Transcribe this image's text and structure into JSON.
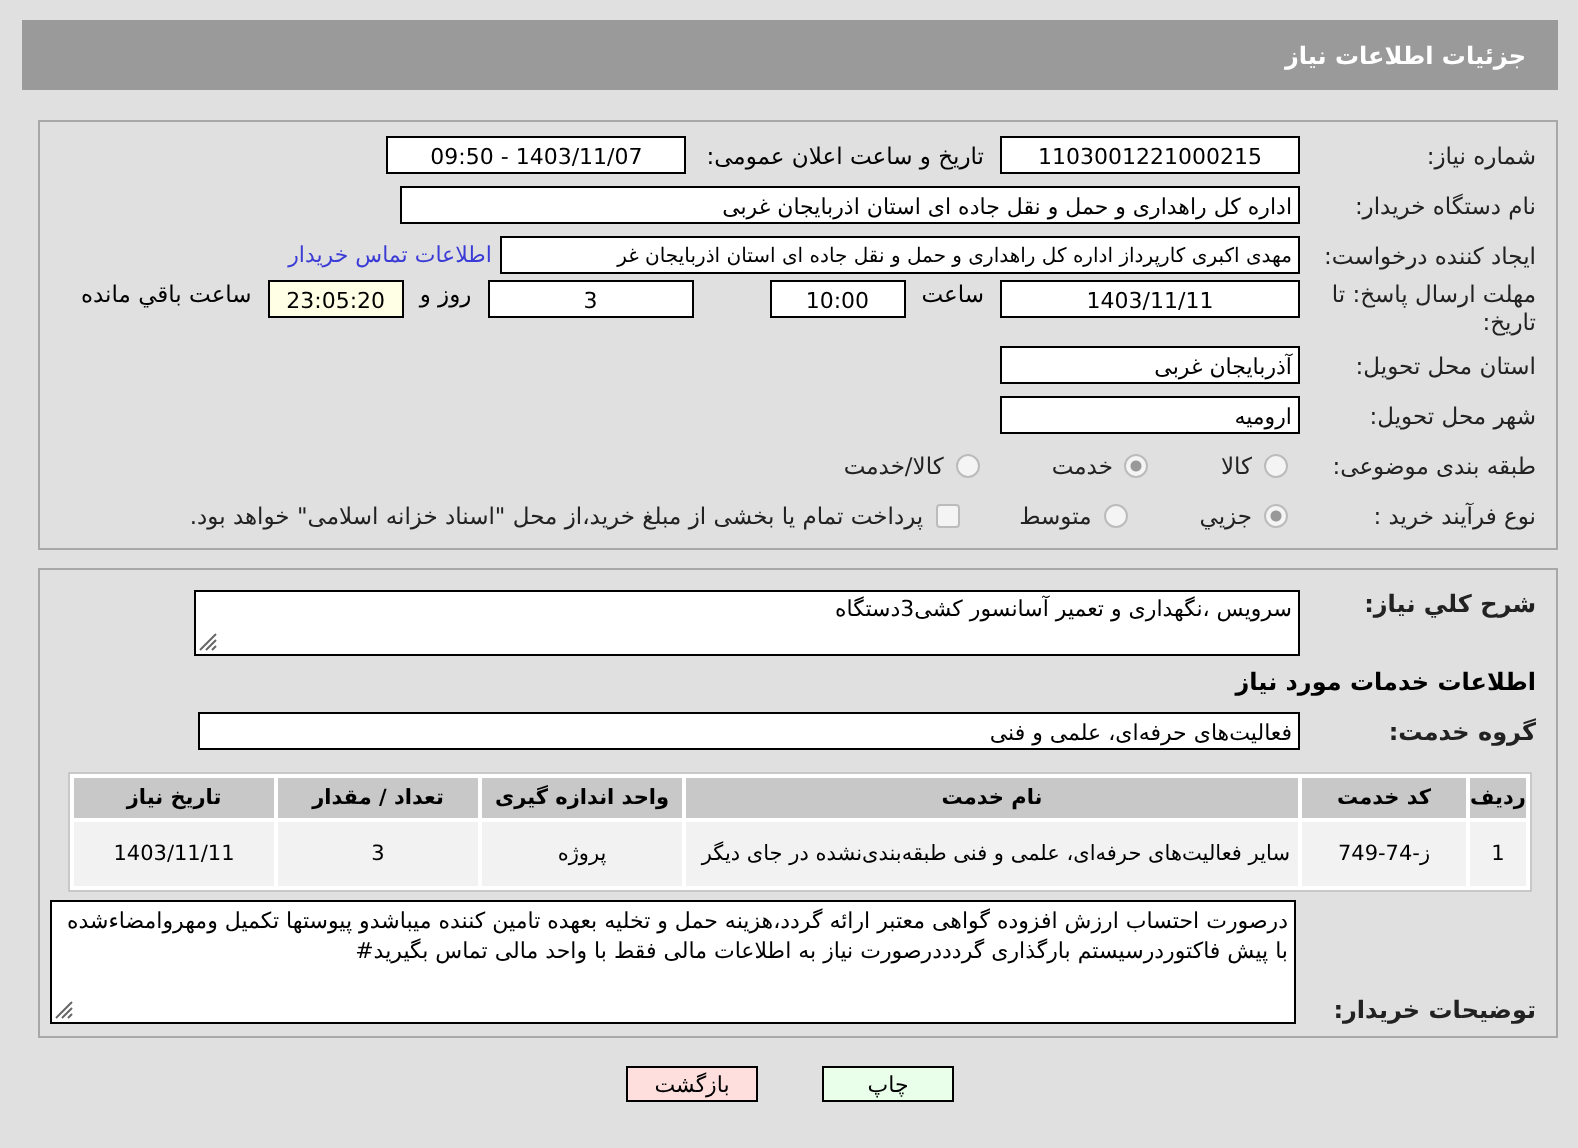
{
  "header": {
    "title": "جزئیات اطلاعات نیاز"
  },
  "need_number": {
    "label": "شماره نیاز:",
    "value": "1103001221000215"
  },
  "announce": {
    "label": "تاریخ و ساعت اعلان عمومی:",
    "value": "1403/11/07 - 09:50"
  },
  "buyer": {
    "label": "نام دستگاه خریدار:",
    "value": "اداره کل راهداری و حمل و نقل جاده ای استان اذربایجان غربی"
  },
  "creator": {
    "label": "ایجاد کننده درخواست:",
    "value": "مهدی اکبری کارپرداز اداره کل راهداری و حمل و نقل جاده ای استان اذربایجان غر",
    "link": "اطلاعات تماس خریدار"
  },
  "deadline": {
    "label": "مهلت ارسال پاسخ: تا تاریخ:",
    "date": "1403/11/11",
    "time_label": "ساعت",
    "time": "10:00",
    "days": "3",
    "days_label": "روز و",
    "remaining": "23:05:20",
    "remaining_label": "ساعت باقي مانده"
  },
  "province": {
    "label": "استان محل تحویل:",
    "value": "آذربایجان غربی"
  },
  "city": {
    "label": "شهر محل تحویل:",
    "value": "ارومیه"
  },
  "category": {
    "label": "طبقه بندی موضوعی:",
    "options": [
      {
        "label": "کالا",
        "selected": false
      },
      {
        "label": "خدمت",
        "selected": true
      },
      {
        "label": "کالا/خدمت",
        "selected": false
      }
    ]
  },
  "process": {
    "label": "نوع فرآیند خرید :",
    "options": [
      {
        "label": "جزیي",
        "selected": true
      },
      {
        "label": "متوسط",
        "selected": false
      }
    ],
    "treasury": {
      "label": "پرداخت تمام یا بخشی از مبلغ خرید،از محل \"اسناد خزانه اسلامی\" خواهد بود.",
      "checked": false
    }
  },
  "summary": {
    "label": "شرح کلي نیاز:",
    "value": "سرویس ،نگهداری و تعمیر آسانسور کشی3دستگاه"
  },
  "services_title": "اطلاعات خدمات مورد نیاز",
  "service_group": {
    "label": "گروه خدمت:",
    "value": "فعالیت‌های حرفه‌ای، علمی و فنی"
  },
  "table": {
    "columns": [
      "ردیف",
      "کد خدمت",
      "نام خدمت",
      "واحد اندازه گیری",
      "تعداد / مقدار",
      "تاریخ نیاز"
    ],
    "rows": [
      [
        "1",
        "ز-74-749",
        "سایر فعالیت‌های حرفه‌ای، علمی و فنی طبقه‌بندی‌نشده در جای دیگر",
        "پروژه",
        "3",
        "1403/11/11"
      ]
    ]
  },
  "buyer_notes": {
    "label": "توضیحات خریدار:",
    "value": "درصورت احتساب ارزش افزوده گواهی معتبر ارائه گردد،هزینه حمل و تخلیه بعهده تامین کننده میباشدو پیوستها تکمیل ومهروامضاءشده با پیش فاکتوردرسیستم بارگذاری گردددرصورت نیاز به اطلاعات مالی فقط با واحد مالی تماس بگیرید#"
  },
  "buttons": [
    {
      "label": "چاپ",
      "kind": "print"
    },
    {
      "label": "بازگشت",
      "kind": "back"
    }
  ]
}
